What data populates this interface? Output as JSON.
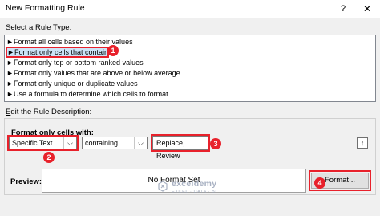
{
  "window": {
    "title": "New Formatting Rule",
    "help_glyph": "?",
    "close_glyph": "✕"
  },
  "rule_type": {
    "label_hotkey": "S",
    "label_rest": "elect a Rule Type:",
    "items": [
      {
        "label": "Format all cells based on their values"
      },
      {
        "label": "Format only cells that contain"
      },
      {
        "label": "Format only top or bottom ranked values"
      },
      {
        "label": "Format only values that are above or below average"
      },
      {
        "label": "Format only unique or duplicate values"
      },
      {
        "label": "Use a formula to determine which cells to format"
      }
    ],
    "selected_index": 1,
    "bullet": "►"
  },
  "rule_description": {
    "label_hotkey": "E",
    "label_rest": "dit the Rule Description:",
    "format_only_label": "Format only cells with:",
    "cell_value_combo": "Specific Text",
    "operator_combo": "containing",
    "value_input": "Replace, Review",
    "preview_label": "Preview:",
    "preview_text": "No Format Set",
    "format_button": "Format..."
  },
  "badges": [
    "1",
    "2",
    "3",
    "4"
  ],
  "watermark": {
    "brand": "exceldemy",
    "tagline": "EXCEL · DATA · BI"
  },
  "colors": {
    "highlight_red": "#e8212b",
    "selection_blue": "#cce4f7"
  }
}
